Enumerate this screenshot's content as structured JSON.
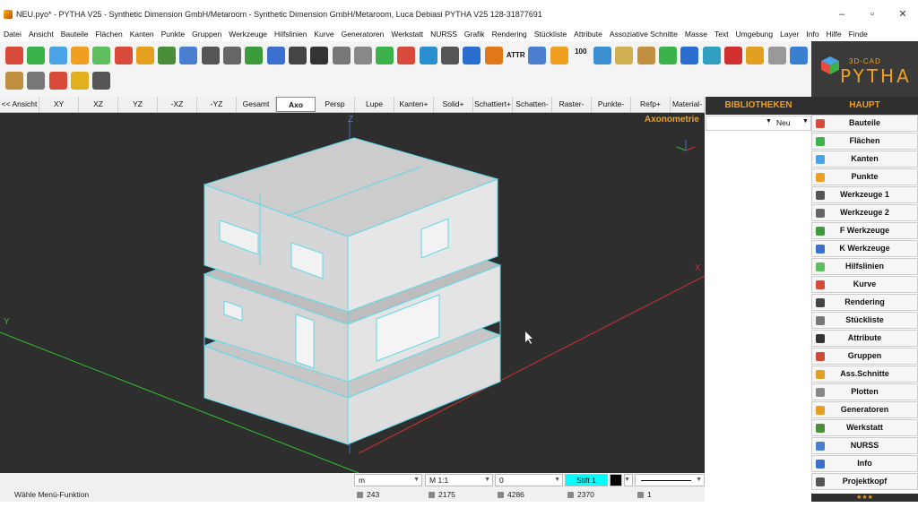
{
  "window": {
    "title": "NEU.pyo* - PYTHA V25 - Synthetic Dimension GmbH/Metaroom - Synthetic Dimension GmbH/Metaroom, Luca Debiasi   PYTHA V25   128-31877691",
    "minimize": "–",
    "maximize": "▫",
    "close": "✕"
  },
  "menu": [
    "Datei",
    "Ansicht",
    "Bauteile",
    "Flächen",
    "Kanten",
    "Punkte",
    "Gruppen",
    "Werkzeuge",
    "Hilfslinien",
    "Kurve",
    "Generatoren",
    "Werkstatt",
    "NURSS",
    "Grafik",
    "Rendering",
    "Stückliste",
    "Attribute",
    "Assoziative Schnitte",
    "Masse",
    "Text",
    "Umgebung",
    "Layer",
    "Info",
    "Hilfe",
    "Finde"
  ],
  "toolbar": {
    "attr_label": "ATTR",
    "num_label": "100"
  },
  "logo": {
    "sub": "3D-CAD",
    "name": "PYTHA"
  },
  "viewbar": [
    "<< Ansicht",
    "XY",
    "XZ",
    "YZ",
    "-XZ",
    "-YZ",
    "Gesamt",
    "Axo",
    "Persp",
    "Lupe",
    "Kanten+",
    "Solid+",
    "Schattiert+",
    "Schatten-",
    "Raster-",
    "Punkte-",
    "Refp+",
    "Material-"
  ],
  "viewbar_active": "Axo",
  "viewport": {
    "mode": "Axonometrie",
    "axis_z": "Z",
    "axis_x": "X",
    "axis_y": "Y"
  },
  "inputs": {
    "unit": "m",
    "scale": "M 1:1",
    "layer": "0",
    "pen": "Stift 1"
  },
  "status": {
    "message": "Wähle Menü-Funktion",
    "count1": "243",
    "count2": "2175",
    "count3": "4286",
    "count4": "2370",
    "count5": "1"
  },
  "panels": {
    "bibliotheken": "BIBLIOTHEKEN",
    "haupt": "HAUPT",
    "lib_value": "Neu"
  },
  "main_items": [
    "Bauteile",
    "Flächen",
    "Kanten",
    "Punkte",
    "Werkzeuge 1",
    "Werkzeuge 2",
    "F Werkzeuge",
    "K Werkzeuge",
    "Hilfslinien",
    "Kurve",
    "Rendering",
    "Stückliste",
    "Attribute",
    "Gruppen",
    "Ass.Schnitte",
    "Plotten",
    "Generatoren",
    "Werkstatt",
    "NURSS",
    "Info",
    "Projektkopf"
  ],
  "stars": "★★★",
  "colors": {
    "accent": "#f0a020",
    "viewport_bg": "#2e2e2e",
    "edge_color": "#5fd8ec",
    "pen_color": "#00ffff"
  }
}
